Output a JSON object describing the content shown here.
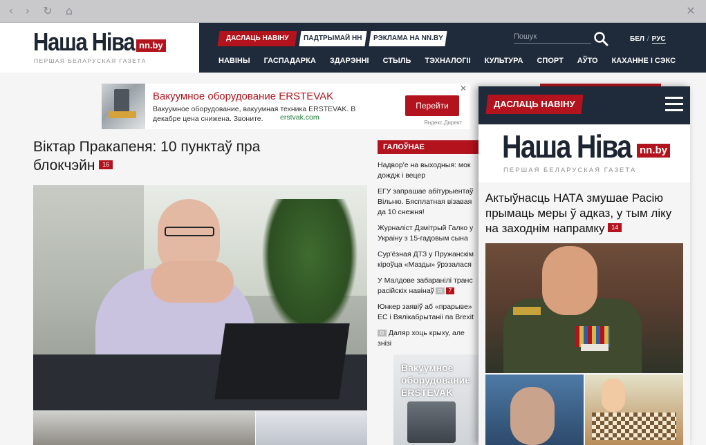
{
  "browser": {
    "back_glyph": "‹",
    "forward_glyph": "›",
    "reload_glyph": "↻",
    "home_glyph": "⌂",
    "close_glyph": "✕"
  },
  "site": {
    "logo_text": "Наша Ніва",
    "logo_badge": "nn.by",
    "tagline": "ПЕРШАЯ БЕЛАРУСКАЯ ГАЗЕТА",
    "brand_red": "#b3131c",
    "nav_bg": "#1f2a3a"
  },
  "header": {
    "pills": [
      "ДАСЛАЦЬ НАВІНУ",
      "ПАДТРЫМАЙ НН",
      "РЭКЛАМА НА NN.BY"
    ],
    "search_placeholder": "Пошук",
    "lang_be": "БЕЛ",
    "lang_sep": "/",
    "lang_ru": "РУС",
    "menu": [
      "НАВІНЫ",
      "ГАСПАДАРКА",
      "ЗДАРЭННІ",
      "СТЫЛЬ",
      "ТЭХНАЛОГІІ",
      "КУЛЬТУРА",
      "СПОРТ",
      "АЎТО",
      "КАХАННЕ І СЭКС"
    ]
  },
  "ad": {
    "title": "Вакуумное оборудование ERSTEVAK",
    "text": "Вакуумное оборудование, вакуумная техника ERSTEVAK. В декабре цена снижена. Звоните.",
    "link": "erstvak.com",
    "button": "Перейти",
    "close": "✕",
    "source": "Яндекс.Директ"
  },
  "main_article": {
    "title": "Віктар Пракапеня: 10 пунктаў пра блокчэйн",
    "comments": "16"
  },
  "galounae": {
    "heading": "ГАЛОЎНАЕ",
    "items": [
      {
        "text": "Надвор'е на выходныя: мок\nдождж і вецер"
      },
      {
        "text": "ЕГУ запрашае абітурыентаў\nВільню. Бясплатная візавая\nда 10 снежня!"
      },
      {
        "text": "Журналіст Дзмітрый Галко у\nУкраіну з 15-гадовым сына"
      },
      {
        "text": "Сур'ёзная ДТЗ у Пружанскім\nкіроўца «Мазды» ўрэзалася"
      },
      {
        "text": "У Малдове забаранілі транс\nрасійскіх навінаў",
        "cam": "◘",
        "count": "7"
      },
      {
        "text": "Юнкер заявіў аб «прарыве»\nЕС і Вялікабрытаніі па Brexit"
      },
      {
        "text": "Даляр хоць крыху, але знізі",
        "cam": "◘"
      }
    ]
  },
  "promo": {
    "text": "Вакуумное оборудование ERSTEVAK"
  },
  "mobile": {
    "cta": "ДАСЛАЦЬ НАВІНУ",
    "logo_text": "Наша Ніва",
    "logo_badge": "nn.by",
    "tagline": "ПЕРШАЯ БЕЛАРУСКАЯ ГАЗЕТА",
    "article_title": "Актыўнасць НАТА змушае Расію прымаць меры ў адказ, у тым ліку на заходнім напрамку",
    "comments": "14"
  }
}
